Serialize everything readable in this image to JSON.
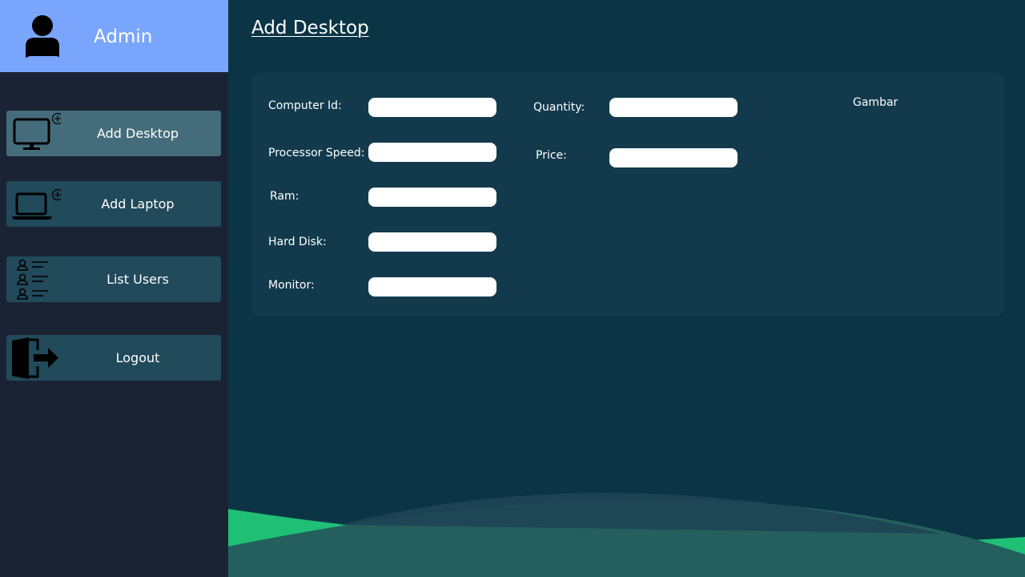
{
  "sidebar": {
    "user_name": "Admin",
    "items": [
      {
        "label": "Add Desktop",
        "icon": "desktop-add-icon"
      },
      {
        "label": "Add Laptop",
        "icon": "laptop-add-icon"
      },
      {
        "label": "List Users",
        "icon": "user-list-icon"
      },
      {
        "label": "Logout",
        "icon": "logout-icon"
      }
    ]
  },
  "page": {
    "title": "Add Desktop"
  },
  "form": {
    "computer_id": {
      "label": "Computer Id:",
      "value": ""
    },
    "processor_speed": {
      "label": "Processor Speed:",
      "value": ""
    },
    "ram": {
      "label": "Ram:",
      "value": ""
    },
    "hard_disk": {
      "label": "Hard Disk:",
      "value": ""
    },
    "monitor": {
      "label": "Monitor:",
      "value": ""
    },
    "quantity": {
      "label": "Quantity:",
      "value": ""
    },
    "price": {
      "label": "Price:",
      "value": ""
    },
    "image_label": "Gambar"
  },
  "colors": {
    "header_bg": "#7aa5fc",
    "sidebar_bg": "#1a2333",
    "main_bg": "#0b3545",
    "card_bg": "#123a4c",
    "nav_item_bg": "#214a5a",
    "nav_item_active_bg": "#446c7a",
    "wave_green": "#1fbf75",
    "wave_teal": "#245f5d"
  }
}
